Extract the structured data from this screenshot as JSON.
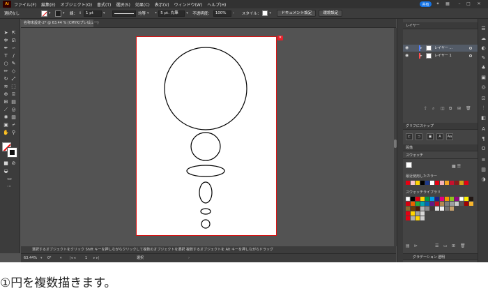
{
  "app": {
    "logo": "Ai"
  },
  "menu": [
    "ファイル(F)",
    "編集(E)",
    "オブジェクト(O)",
    "書式(T)",
    "選択(S)",
    "効果(C)",
    "表示(V)",
    "ウィンドウ(W)",
    "ヘルプ(H)"
  ],
  "share_label": "共有",
  "control": {
    "selection_status": "選択なし",
    "stroke_label": "線：",
    "stroke_weight": "1 pt",
    "line_style_label": "均等",
    "brush_label": "5 pt. 丸筆",
    "opacity_label": "不透明度：",
    "opacity_value": "100%",
    "style_label": "スタイル：",
    "doc_settings_button": "ドキュメント設定",
    "prefs_button": "環境設定"
  },
  "document_tab": {
    "title": "名称未設定-2* @ 63.44 % (CMYK/プレビュー)",
    "close": "×"
  },
  "status": {
    "hint": "選択するオブジェクトをクリック  Shift キーを押しながらクリックして複数のオブジェクトを選択  複数するオブジェクトを Alt キーを押しながらドラッグ",
    "zoom": "63.44%",
    "rotation": "0°",
    "artboard_num": "1",
    "tool": "選択"
  },
  "layers_panel": {
    "tab": "レイヤー",
    "layers": [
      {
        "name": "レイヤー ...",
        "selected": true,
        "color": "#4f7fff"
      },
      {
        "name": "レイヤー 1",
        "selected": false,
        "color": "#ff4f4f"
      }
    ]
  },
  "glyph_snap_panel": {
    "tab": "グリフにスナップ"
  },
  "swatches_panel": {
    "tab1": "段落",
    "tab2": "スウォッチ",
    "recent_label": "最近使用したカラー",
    "library_label": "スウォッチライブラリ"
  },
  "bottom_tabs": [
    "グラデーション",
    "透明"
  ],
  "caption": "①円を複数描きます。"
}
